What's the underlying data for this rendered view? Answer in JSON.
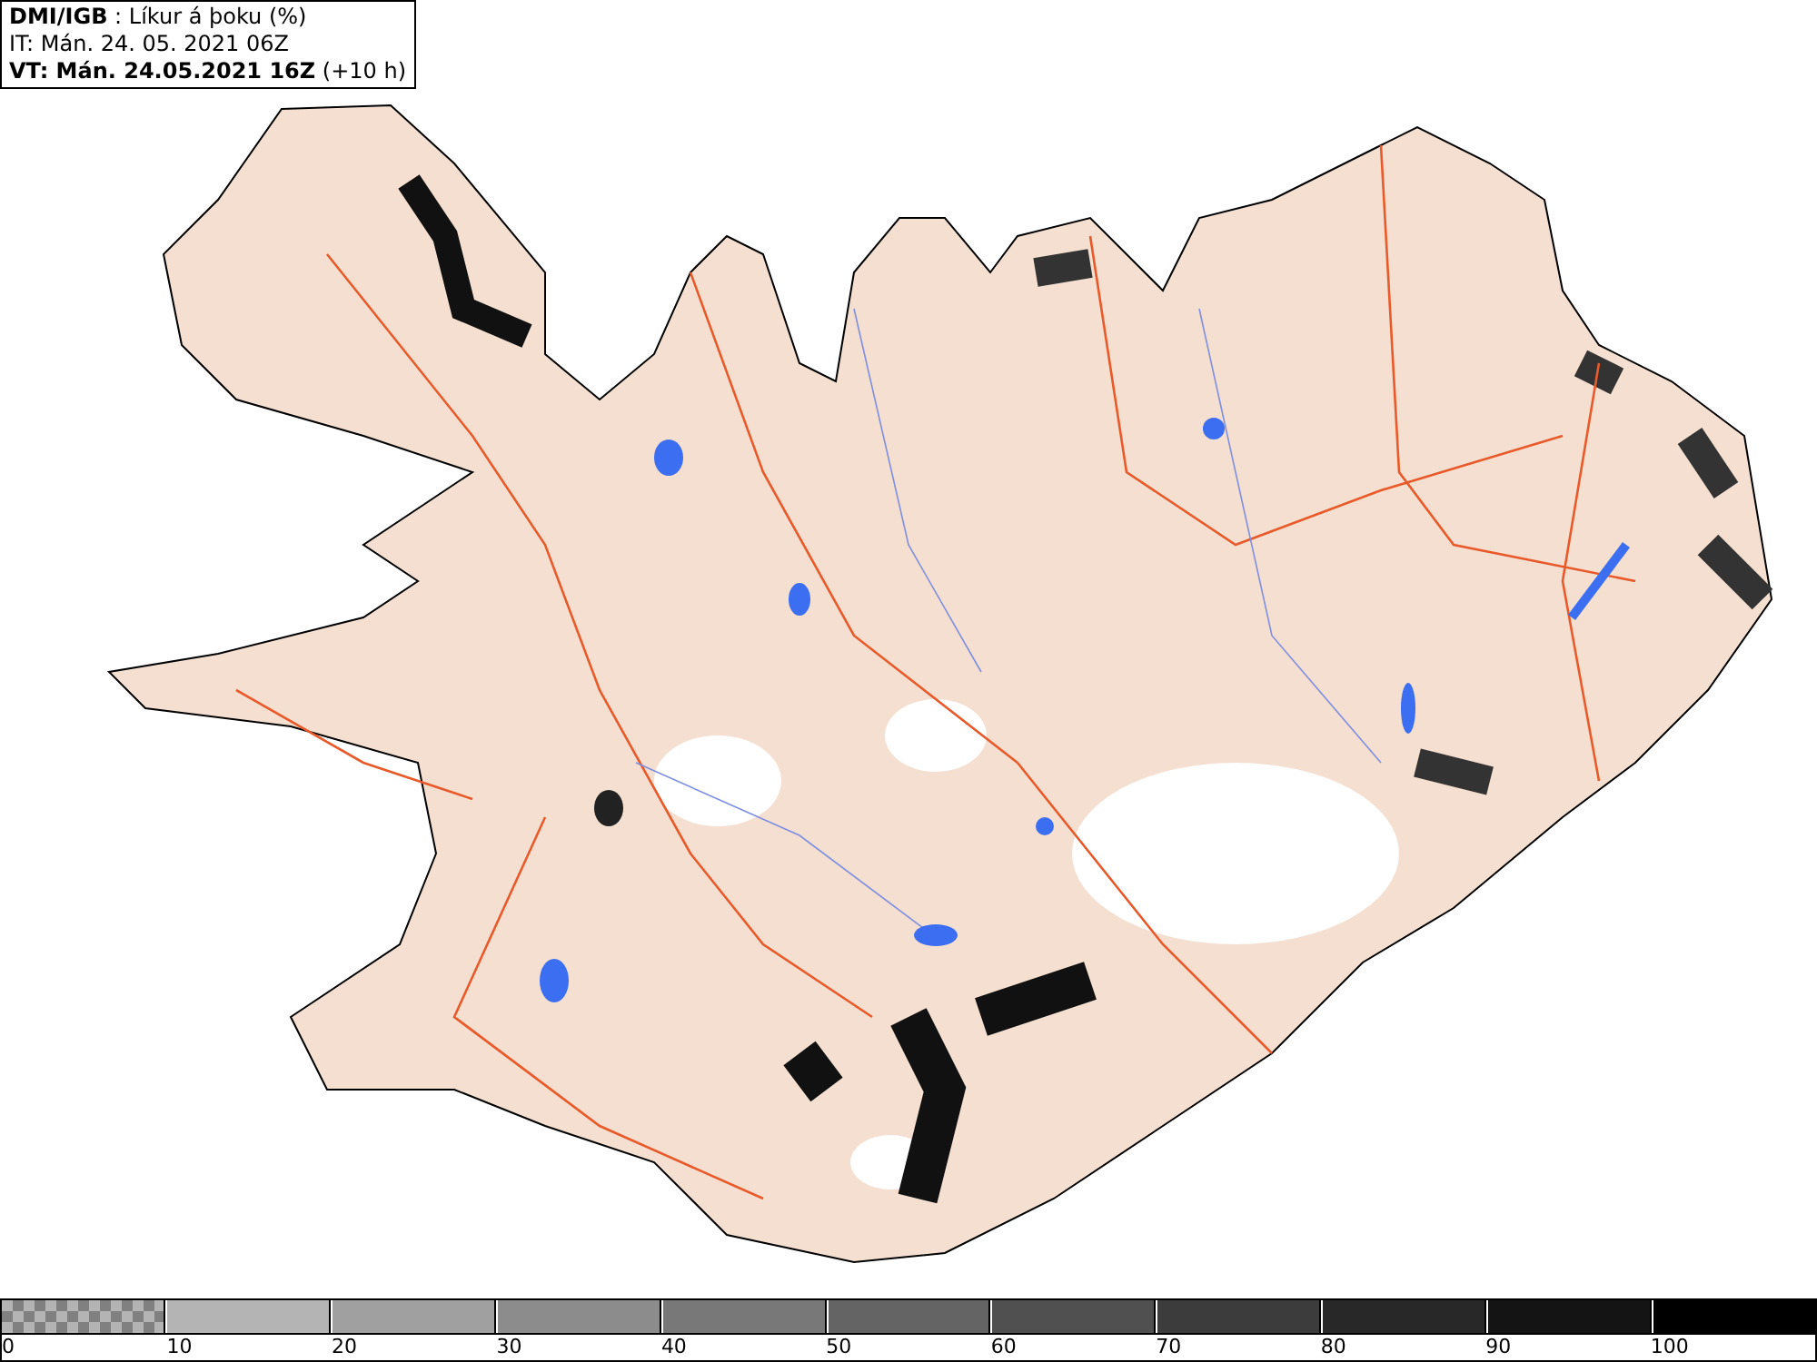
{
  "header": {
    "lines": [
      "**DMI/IGB** : Líkur á þoku (%)",
      "IT: Mán. 24. 05. 2021 06Z",
      "**VT: Mán. 24.05.2021 16Z** (+10 h)"
    ]
  },
  "legend": {
    "segments": [
      {
        "kind": "checker",
        "color": "#808080"
      },
      {
        "kind": "solid",
        "color": "#b4b4b4"
      },
      {
        "kind": "solid",
        "color": "#a0a0a0"
      },
      {
        "kind": "solid",
        "color": "#8c8c8c"
      },
      {
        "kind": "solid",
        "color": "#787878"
      },
      {
        "kind": "solid",
        "color": "#646464"
      },
      {
        "kind": "solid",
        "color": "#505050"
      },
      {
        "kind": "solid",
        "color": "#3c3c3c"
      },
      {
        "kind": "solid",
        "color": "#282828"
      },
      {
        "kind": "solid",
        "color": "#141414"
      },
      {
        "kind": "solid",
        "color": "#000000"
      }
    ],
    "labels": [
      "0",
      "10",
      "20",
      "30",
      "40",
      "50",
      "60",
      "70",
      "80",
      "90",
      "100"
    ]
  }
}
